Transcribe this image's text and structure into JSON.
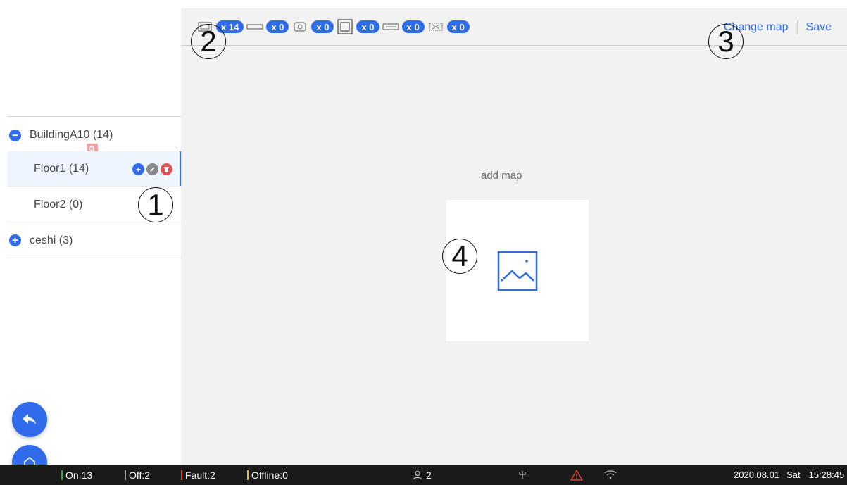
{
  "sidebar": {
    "building": {
      "label": "BuildingA10 (14)",
      "toggle": "−"
    },
    "floors": [
      {
        "label": "Floor1 (14)"
      },
      {
        "label": "Floor2 (0)"
      }
    ],
    "other": {
      "label": "ceshi (3)",
      "toggle": "+"
    },
    "actions": {
      "add": "+",
      "edit": "✎",
      "delete": "🗑"
    }
  },
  "toolbar": {
    "device_counts": [
      "x 14",
      "x 0",
      "x 0",
      "x 0",
      "x 0",
      "x 0"
    ],
    "change_map": "Change map",
    "save": "Save"
  },
  "main": {
    "add_map_label": "add map"
  },
  "callouts": [
    "1",
    "2",
    "3",
    "4"
  ],
  "statusbar": {
    "on": "On:13",
    "off": "Off:2",
    "fault": "Fault:2",
    "offline": "Offline:0",
    "users": "2",
    "date": "2020.08.01",
    "day": "Sat",
    "time": "15:28:45"
  },
  "colors": {
    "accent": "#2f6bea",
    "on": "#2eaa44",
    "off": "#9e9e9e",
    "fault": "#e2402b",
    "offline": "#e6c21c"
  },
  "icons": [
    "search-icon",
    "image-icon",
    "back-arrow-icon",
    "home-icon",
    "user-icon",
    "antenna-icon",
    "warning-icon",
    "wifi-icon"
  ]
}
